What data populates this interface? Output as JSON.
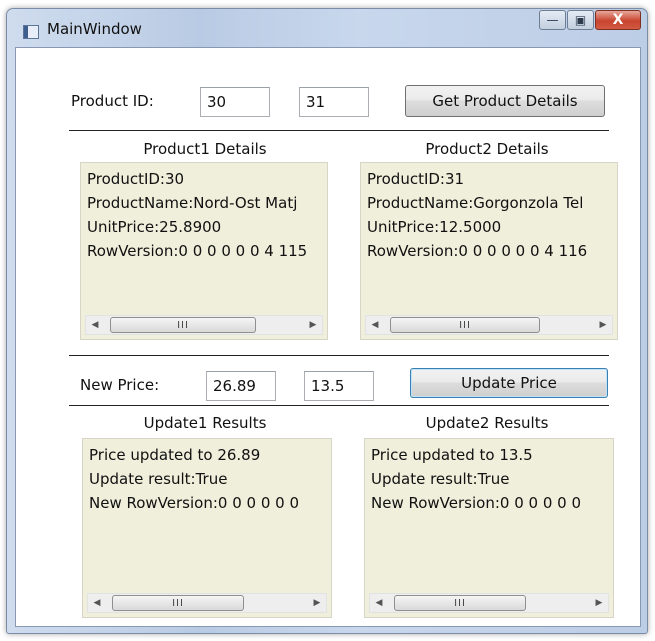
{
  "window": {
    "title": "MainWindow",
    "minimize_glyph": "—",
    "maximize_glyph": "▣",
    "close_glyph": "X"
  },
  "product_row": {
    "label": "Product ID:",
    "id1_value": "30",
    "id2_value": "31",
    "get_button": "Get Product Details"
  },
  "product1": {
    "header": "Product1 Details",
    "lines": [
      "ProductID:30",
      "ProductName:Nord-Ost Matj",
      "UnitPrice:25.8900",
      "RowVersion:0 0 0 0 0 0 4 115"
    ]
  },
  "product2": {
    "header": "Product2 Details",
    "lines": [
      "ProductID:31",
      "ProductName:Gorgonzola Tel",
      "UnitPrice:12.5000",
      "RowVersion:0 0 0 0 0 0 4 116"
    ]
  },
  "price_row": {
    "label": "New Price:",
    "price1_value": "26.89",
    "price2_value": "13.5",
    "update_button": "Update Price"
  },
  "update1": {
    "header": "Update1 Results",
    "lines": [
      "Price updated to 26.89",
      "Update result:True",
      "New RowVersion:0 0 0 0 0 0"
    ]
  },
  "update2": {
    "header": "Update2 Results",
    "lines": [
      "Price updated to 13.5",
      "Update result:True",
      "New RowVersion:0 0 0 0 0 0"
    ]
  },
  "scrollbar": {
    "left_arrow": "◀",
    "right_arrow": "▶",
    "thumb_grip": "III"
  }
}
